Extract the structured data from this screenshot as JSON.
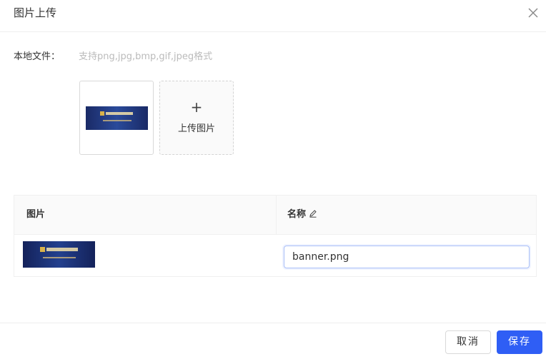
{
  "dialog": {
    "title": "图片上传"
  },
  "form": {
    "local_file_label": "本地文件：",
    "hint": "支持png,jpg,bmp,gif,jpeg格式",
    "upload_plus": "+",
    "upload_label": "上传图片"
  },
  "table": {
    "columns": [
      "图片",
      "名称"
    ],
    "rows": [
      {
        "name": "banner.png"
      }
    ]
  },
  "footer": {
    "cancel_label": "取消",
    "save_label": "保存"
  },
  "colors": {
    "primary": "#2f5ef5",
    "banner_bg": "#1e3270",
    "banner_gold": "#d9b24a"
  }
}
